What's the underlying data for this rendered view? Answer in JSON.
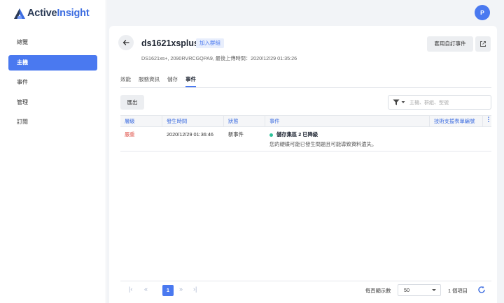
{
  "app": {
    "brand_a": "Active",
    "brand_b": "Insight",
    "avatar_letter": "P",
    "accent": "#4a79f0"
  },
  "sidebar": {
    "items": [
      {
        "label": "總覽",
        "active": false
      },
      {
        "label": "主機",
        "active": true
      },
      {
        "label": "事件",
        "active": false
      },
      {
        "label": "管理",
        "active": false
      },
      {
        "label": "訂閱",
        "active": false
      }
    ]
  },
  "header": {
    "title": "ds1621xsplus",
    "tag": "加入群組",
    "subtitle": "DS1621xs+, 2090RVRCGQPA9, 最後上傳時間：2020/12/29 01:35:26",
    "custom_event_button": "套用自訂事件"
  },
  "tabs": [
    {
      "label": "效能",
      "active": false
    },
    {
      "label": "服務資訊",
      "active": false
    },
    {
      "label": "儲存",
      "active": false
    },
    {
      "label": "事件",
      "active": true
    }
  ],
  "toolbar": {
    "export_label": "匯出",
    "filter_placeholder": "主機、群組、型號"
  },
  "table": {
    "columns": [
      "層級",
      "發生時間",
      "狀態",
      "事件",
      "技術支援表單編號"
    ],
    "rows": [
      {
        "level": "嚴重",
        "time": "2020/12/29 01:36:46",
        "status": "新事件",
        "event_title": "儲存集區 2 已降級",
        "event_desc": "您的硬碟可能已發生問題且可能導致資料遺失。",
        "ticket": ""
      }
    ]
  },
  "pagination": {
    "current_page": "1",
    "per_page_label": "每頁顯示數",
    "per_page_value": "50",
    "total_label": "1 個項目"
  }
}
